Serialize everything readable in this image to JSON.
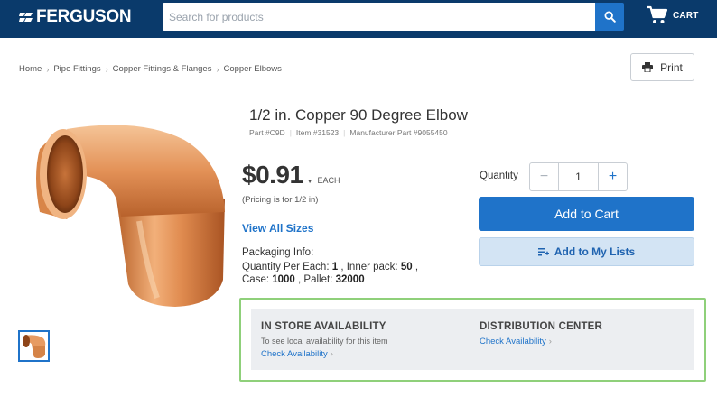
{
  "header": {
    "logo_text": "FERGUSON",
    "search_placeholder": "Search for products",
    "cart_label": "CART"
  },
  "breadcrumb": [
    "Home",
    "Pipe Fittings",
    "Copper Fittings & Flanges",
    "Copper Elbows"
  ],
  "print_label": "Print",
  "product": {
    "title": "1/2 in. Copper 90 Degree Elbow",
    "part": "Part #C9D",
    "item": "Item #31523",
    "manufacturer_part": "Manufacturer Part #9055450",
    "price": "$0.91",
    "price_unit": "EACH",
    "pricing_note": "(Pricing is for 1/2 in)",
    "view_all_sizes": "View All Sizes",
    "packaging": {
      "title": "Packaging Info:",
      "qty_per_each_label": "Quantity Per Each:",
      "qty_per_each": "1",
      "inner_pack_label": ", Inner pack:",
      "inner_pack": "50",
      "case_label": "Case:",
      "case": "1000",
      "pallet_label": ", Pallet:",
      "pallet": "32000",
      "trailing_comma": ","
    }
  },
  "purchase": {
    "quantity_label": "Quantity",
    "quantity_value": "1",
    "minus": "−",
    "plus": "+",
    "add_to_cart": "Add to Cart",
    "add_to_lists": "Add to My Lists"
  },
  "availability": {
    "store_heading": "IN STORE AVAILABILITY",
    "store_sub": "To see local availability for this item",
    "store_link": "Check Availability",
    "dc_heading": "DISTRIBUTION CENTER",
    "dc_link": "Check Availability"
  },
  "colors": {
    "header_bg": "#0a3a6b",
    "accent": "#1f73c9",
    "highlight_frame": "#8fd07a"
  },
  "icons": [
    "ferguson-logo-icon",
    "search-icon",
    "cart-icon",
    "print-icon",
    "add-list-icon",
    "chevron-right-icon"
  ]
}
